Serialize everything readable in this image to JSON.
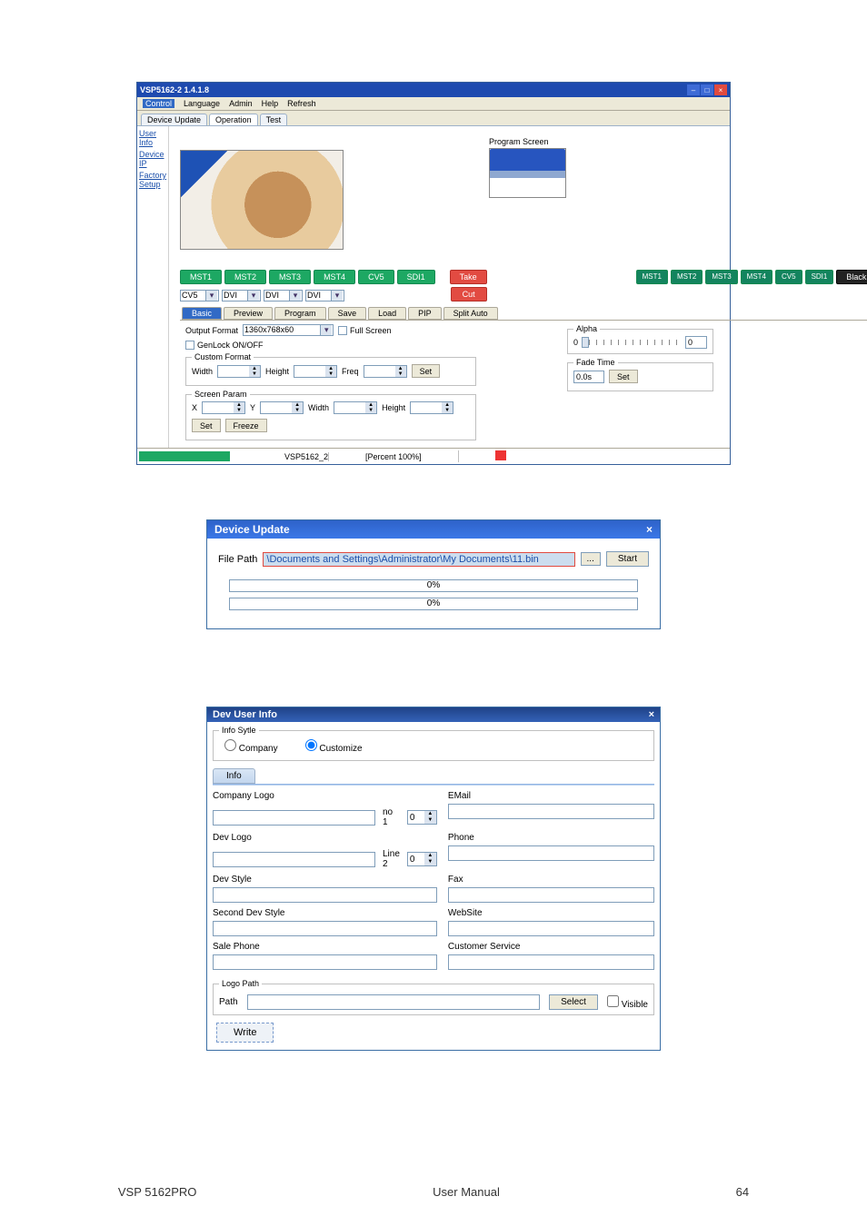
{
  "app": {
    "title": "VSP5162-2 1.4.1.8",
    "menu": [
      "Control",
      "Language",
      "Admin",
      "Help",
      "Refresh"
    ],
    "top_tabs": [
      "Device Update",
      "Operation",
      "Test"
    ],
    "left_list": [
      "User Info",
      "Device IP",
      "Factory Setup"
    ],
    "program_label": "Program Screen",
    "mst_buttons": [
      "MST1",
      "MST2",
      "MST3",
      "MST4",
      "CV5",
      "SDI1"
    ],
    "take_btn": "Take",
    "cut_btn": "Cut",
    "prog_buttons": [
      "MST1",
      "MST2",
      "MST3",
      "MST4",
      "CV5",
      "SDI1",
      "Black"
    ],
    "selects": [
      "CV5",
      "DVI",
      "DVI",
      "DVI"
    ],
    "sub_tabs": [
      "Basic",
      "Preview",
      "Program",
      "Save",
      "Load",
      "PIP",
      "Split Auto"
    ],
    "output_format_label": "Output Format",
    "output_format_value": "1360x768x60",
    "full_screen": "Full Screen",
    "genlock": "GenLock ON/OFF",
    "custom_format_label": "Custom Format",
    "width_label": "Width",
    "height_label": "Height",
    "freq_label": "Freq",
    "set_btn": "Set",
    "screen_param_label": "Screen Param",
    "x_label": "X",
    "y_label": "Y",
    "freeze_btn": "Freeze",
    "alpha_label": "Alpha",
    "alpha_val": "0",
    "fade_label": "Fade Time",
    "fade_val": "0.0s",
    "status_left": "VSP5162_2",
    "status_mid": "[Percent 100%]"
  },
  "update": {
    "title": "Device Update",
    "close_x": "×",
    "file_path_label": "File Path",
    "file_path_value": "\\Documents and Settings\\Administrator\\My Documents\\11.bin",
    "browse": "...",
    "start": "Start",
    "prog1": "0%",
    "prog2": "0%"
  },
  "devuser": {
    "title": "Dev User Info",
    "close_x": "×",
    "style_legend": "Info Sytle",
    "radio_company": "Company",
    "radio_custom": "Customize",
    "info_tab": "Info",
    "labels": {
      "company_logo": "Company Logo",
      "email": "EMail",
      "dev_logo": "Dev Logo",
      "phone": "Phone",
      "dev_style": "Dev Style",
      "fax": "Fax",
      "second_dev_style": "Second Dev Style",
      "website": "WebSite",
      "sale_phone": "Sale Phone",
      "customer_service": "Customer Service",
      "logo_path": "Logo Path",
      "path": "Path"
    },
    "no1_label": "no 1",
    "line2_label": "Line 2",
    "no1_val": "0",
    "line2_val": "0",
    "select_btn": "Select",
    "visible": "Visible",
    "write_btn": "Write"
  },
  "footer": {
    "left": "VSP 5162PRO",
    "mid": "User Manual",
    "page": "64"
  }
}
